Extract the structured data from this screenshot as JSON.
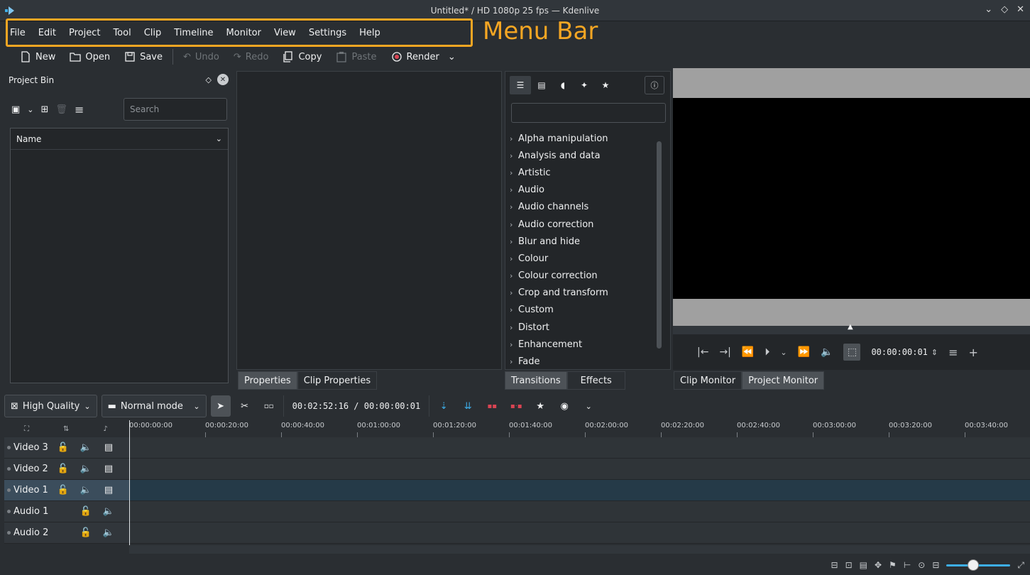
{
  "window": {
    "title": "Untitled* / HD 1080p 25 fps — Kdenlive"
  },
  "menu": [
    "File",
    "Edit",
    "Project",
    "Tool",
    "Clip",
    "Timeline",
    "Monitor",
    "View",
    "Settings",
    "Help"
  ],
  "annotation": {
    "label": "Menu Bar",
    "color": "#f5a623"
  },
  "toolbar": {
    "new": "New",
    "open": "Open",
    "save": "Save",
    "undo": "Undo",
    "redo": "Redo",
    "copy": "Copy",
    "paste": "Paste",
    "render": "Render"
  },
  "project_bin": {
    "title": "Project Bin",
    "search_placeholder": "Search",
    "column_name": "Name"
  },
  "effects": {
    "items": [
      "Alpha manipulation",
      "Analysis and data",
      "Artistic",
      "Audio",
      "Audio channels",
      "Audio correction",
      "Blur and hide",
      "Colour",
      "Colour correction",
      "Crop and transform",
      "Custom",
      "Distort",
      "Enhancement",
      "Fade"
    ]
  },
  "monitor": {
    "timecode": "00:00:00:01"
  },
  "tabs": {
    "properties": "Properties",
    "clip_properties": "Clip Properties",
    "transitions": "Transitions",
    "effects": "Effects",
    "clip_monitor": "Clip Monitor",
    "project_monitor": "Project Monitor"
  },
  "timeline_toolbar": {
    "quality": "High Quality",
    "mode": "Normal mode",
    "timecode": "00:02:52:16 / 00:00:00:01"
  },
  "timeline": {
    "ruler": [
      "00:00:00:00",
      "00:00:20:00",
      "00:00:40:00",
      "00:01:00:00",
      "00:01:20:00",
      "00:01:40:00",
      "00:02:00:00",
      "00:02:20:00",
      "00:02:40:00",
      "00:03:00:00",
      "00:03:20:00",
      "00:03:40:00"
    ],
    "tracks": [
      {
        "name": "Video 3",
        "type": "video",
        "active": false
      },
      {
        "name": "Video 2",
        "type": "video",
        "active": false
      },
      {
        "name": "Video 1",
        "type": "video",
        "active": true
      },
      {
        "name": "Audio 1",
        "type": "audio",
        "active": false
      },
      {
        "name": "Audio 2",
        "type": "audio",
        "active": false
      }
    ]
  },
  "colors": {
    "accent": "#3daee9",
    "bg": "#2a2e32",
    "panel": "#232629"
  }
}
